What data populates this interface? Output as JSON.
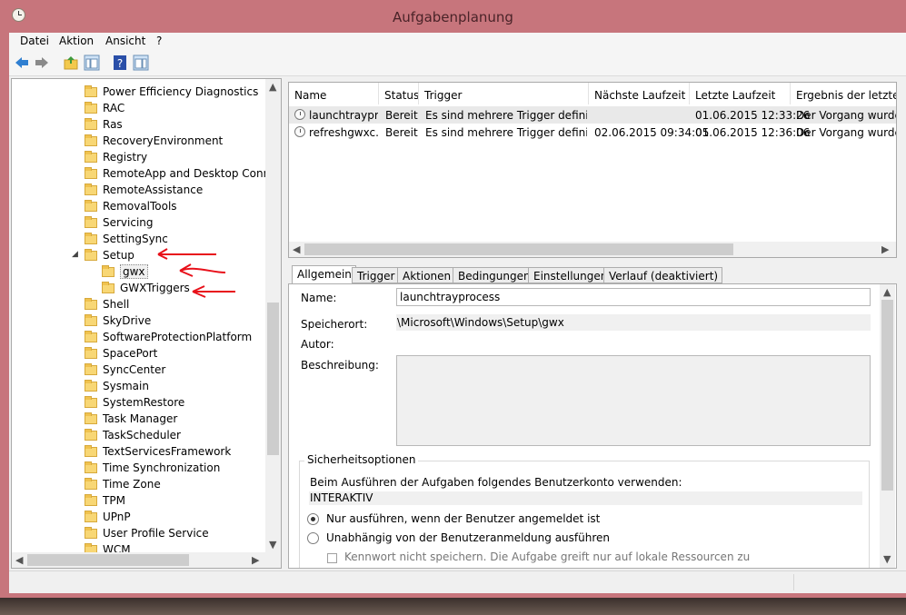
{
  "window": {
    "title": "Aufgabenplanung"
  },
  "menu": [
    "Datei",
    "Aktion",
    "Ansicht",
    "?"
  ],
  "toolbar": {
    "icons": [
      "back-arrow-icon",
      "forward-arrow-icon",
      "up-folder-icon",
      "show-hide-console-tree-icon",
      "help-icon",
      "show-hide-action-pane-icon"
    ]
  },
  "tree": {
    "items": [
      {
        "label": "Power Efficiency Diagnostics"
      },
      {
        "label": "RAC"
      },
      {
        "label": "Ras"
      },
      {
        "label": "RecoveryEnvironment"
      },
      {
        "label": "Registry"
      },
      {
        "label": "RemoteApp and Desktop Connec"
      },
      {
        "label": "RemoteAssistance"
      },
      {
        "label": "RemovalTools"
      },
      {
        "label": "Servicing"
      },
      {
        "label": "SettingSync"
      },
      {
        "label": "Setup",
        "expanded": true
      },
      {
        "label": "gwx",
        "child": true,
        "selected": true
      },
      {
        "label": "GWXTriggers",
        "child": true
      },
      {
        "label": "Shell"
      },
      {
        "label": "SkyDrive"
      },
      {
        "label": "SoftwareProtectionPlatform"
      },
      {
        "label": "SpacePort"
      },
      {
        "label": "SyncCenter"
      },
      {
        "label": "Sysmain"
      },
      {
        "label": "SystemRestore"
      },
      {
        "label": "Task Manager"
      },
      {
        "label": "TaskScheduler"
      },
      {
        "label": "TextServicesFramework"
      },
      {
        "label": "Time Synchronization"
      },
      {
        "label": "Time Zone"
      },
      {
        "label": "TPM"
      },
      {
        "label": "UPnP"
      },
      {
        "label": "User Profile Service"
      },
      {
        "label": "WCM"
      }
    ]
  },
  "tasks": {
    "columns": [
      "Name",
      "Status",
      "Trigger",
      "Nächste Laufzeit",
      "Letzte Laufzeit",
      "Ergebnis der letzten A"
    ],
    "rows": [
      {
        "name": "launchtraypr...",
        "status": "Bereit",
        "trigger": "Es sind mehrere Trigger definiert.",
        "next": "",
        "last": "01.06.2015 12:33:26",
        "result": "Der Vorgang wurde e"
      },
      {
        "name": "refreshgwxc...",
        "status": "Bereit",
        "trigger": "Es sind mehrere Trigger definiert.",
        "next": "02.06.2015 09:34:05",
        "last": "01.06.2015 12:36:06",
        "result": "Der Vorgang wurde e"
      }
    ]
  },
  "tabs": [
    "Allgemein",
    "Trigger",
    "Aktionen",
    "Bedingungen",
    "Einstellungen",
    "Verlauf (deaktiviert)"
  ],
  "general": {
    "name_label": "Name:",
    "name_value": "launchtrayprocess",
    "location_label": "Speicherort:",
    "location_value": "\\Microsoft\\Windows\\Setup\\gwx",
    "author_label": "Autor:",
    "description_label": "Beschreibung:",
    "security_title": "Sicherheitsoptionen",
    "account_text": "Beim Ausführen der Aufgaben folgendes Benutzerkonto verwenden:",
    "account_value": "INTERAKTIV",
    "radio1": "Nur ausführen, wenn der Benutzer angemeldet ist",
    "radio2": "Unabhängig von der Benutzeranmeldung ausführen",
    "checkbox_text": "Kennwort nicht speichern. Die Aufgabe greift nur auf lokale Ressourcen zu"
  },
  "colors": {
    "title_bar": "#c7757c",
    "selection": "#cce8ff",
    "annotation_red": "#e8101a"
  }
}
